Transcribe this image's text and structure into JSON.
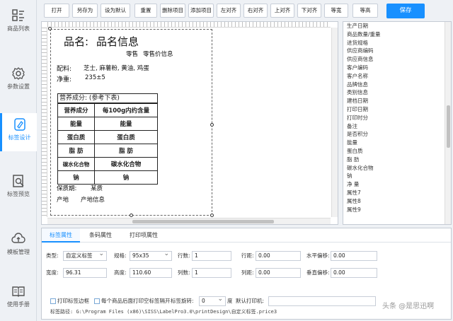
{
  "nav": {
    "items": [
      {
        "label": "商品列表",
        "icon": "product-list-icon"
      },
      {
        "label": "参数设置",
        "icon": "gear-icon"
      },
      {
        "label": "标签设计",
        "icon": "tag-design-icon"
      },
      {
        "label": "标签预览",
        "icon": "preview-icon"
      },
      {
        "label": "模板管理",
        "icon": "cloud-upload-icon"
      },
      {
        "label": "使用手册",
        "icon": "manual-icon"
      }
    ]
  },
  "toolbar": {
    "open": "打开",
    "save_as": "另存为",
    "set_default": "设为默认",
    "redraw": "重置",
    "delete_item": "删除项目",
    "add_item": "添加项目",
    "align_left": "左对齐",
    "align_right": "右对齐",
    "align_top": "上对齐",
    "align_bottom": "下对齐",
    "equal_width": "等宽",
    "equal_height": "等高",
    "save": "保存"
  },
  "label": {
    "name_caption": "品名:",
    "name_value": "品名信息",
    "retail_caption": "零售",
    "retail_value": "零售价信息",
    "ingredients_caption": "配料:",
    "ingredients_value": "芝士, 麻薯粉, 黄油, 鸡蛋",
    "net_caption": "净重:",
    "net_value": "235±5",
    "nutrition_title": "营养成分: (参考下表)",
    "nutrition_rows": [
      [
        "营养成分",
        "每100g内约含量"
      ],
      [
        "能量",
        "能量"
      ],
      [
        "蛋白质",
        "蛋白质"
      ],
      [
        "脂 肪",
        "脂 肪"
      ],
      [
        "碳水化合物",
        "碳水化合物"
      ],
      [
        "钠",
        "钠"
      ]
    ],
    "shelf_caption": "保质期:",
    "shelf_value": "某质",
    "origin_caption": "产地",
    "origin_value": "产地信息"
  },
  "fields": [
    "生产日期",
    "商品数量/重量",
    "进货规格",
    "供应商编码",
    "供应商信息",
    "客户编码",
    "客户名称",
    "品牌信息",
    "类别信息",
    "建档日期",
    "打印日期",
    "打印时分",
    "备注",
    "是否积分",
    "能量",
    "蛋白质",
    "脂 肪",
    "碳水化合物",
    "钠",
    "净 量",
    "属性7",
    "属性8",
    "属性9"
  ],
  "props": {
    "tabs": [
      "标签属性",
      "条码属性",
      "打印项属性"
    ],
    "type_label": "类型:",
    "type_value": "自定义标签",
    "spec_label": "规格:",
    "spec_value": "95x35",
    "rows_label": "行数:",
    "rows_value": "1",
    "row_gap_label": "行距:",
    "row_gap_value": "0.00",
    "h_offset_label": "水平偏移:",
    "h_offset_value": "0.00",
    "width_label": "宽度:",
    "width_value": "96.31",
    "height_label": "高度:",
    "height_value": "110.60",
    "cols_label": "列数:",
    "cols_value": "1",
    "col_gap_label": "列距:",
    "col_gap_value": "0.00",
    "v_offset_label": "垂直偏移:",
    "v_offset_value": "0.00",
    "print_border": "打印标签边框",
    "print_separator": "每个商品后面打印空标签隔开",
    "rotation_label": "标签旋转:",
    "rotation_value": "0",
    "rotation_unit": "度",
    "printer_label": "默认打印机:",
    "path_label": "标签路径:",
    "path_value": "G:\\Program Files (x86)\\SISS\\LabelPro3.0\\printDesign\\自定义标签.price3"
  },
  "watermark": "头条 @是思迅啊"
}
